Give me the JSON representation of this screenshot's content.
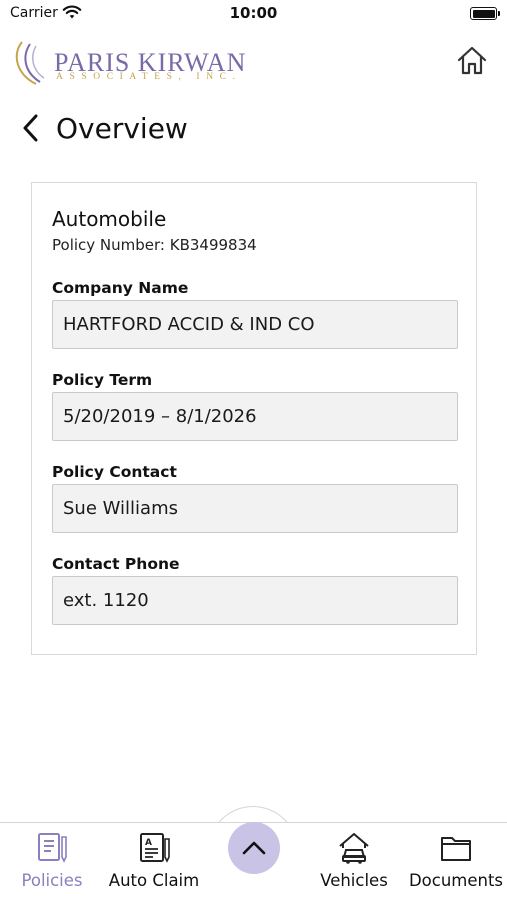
{
  "status_bar": {
    "carrier": "Carrier",
    "time": "10:00"
  },
  "header": {
    "logo_name": "PARIS KIRWAN",
    "logo_sub": "ASSOCIATES, INC.",
    "home_icon": "home-icon"
  },
  "nav": {
    "title": "Overview",
    "back_icon": "chevron-left-icon"
  },
  "policy": {
    "type": "Automobile",
    "number_line": "Policy Number: KB3499834",
    "fields": [
      {
        "label": "Company Name",
        "value": "HARTFORD ACCID & IND CO"
      },
      {
        "label": "Policy Term",
        "value": "5/20/2019 – 8/1/2026"
      },
      {
        "label": "Policy Contact",
        "value": "Sue Williams"
      },
      {
        "label": "Contact Phone",
        "value": "ext. 1120"
      }
    ]
  },
  "tabbar": {
    "tabs": [
      {
        "label": "Policies",
        "icon": "policies-icon",
        "active": true
      },
      {
        "label": "Auto Claim",
        "icon": "auto-claim-icon",
        "active": false
      },
      {
        "label": "Vehicles",
        "icon": "car-house-icon",
        "active": false
      },
      {
        "label": "Documents",
        "icon": "folder-icon",
        "active": false
      }
    ],
    "center_icon": "chevron-up-icon"
  },
  "colors": {
    "accent": "#8a80bf",
    "fab": "#c9c3e6",
    "logo_purple": "#7a6aa8",
    "logo_gold": "#c7a34d"
  }
}
